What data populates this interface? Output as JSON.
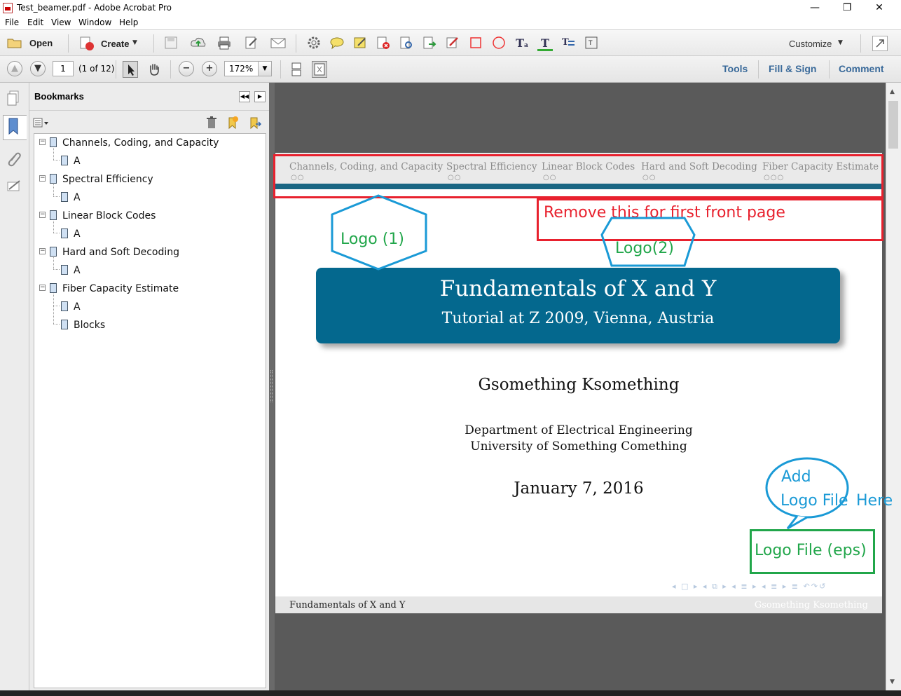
{
  "window": {
    "title": "Test_beamer.pdf - Adobe Acrobat Pro",
    "minimize": "—",
    "restore": "❐",
    "close": "✕"
  },
  "menu": [
    "File",
    "Edit",
    "View",
    "Window",
    "Help"
  ],
  "toolbar": {
    "open_label": "Open",
    "create_label": "Create",
    "customize_label": "Customize",
    "page_number": "1",
    "page_count": "(1 of 12)",
    "zoom": "172%"
  },
  "panes": {
    "tools": "Tools",
    "fill_sign": "Fill & Sign",
    "comment": "Comment"
  },
  "bookmarks": {
    "title": "Bookmarks",
    "items": [
      {
        "label": "Channels, Coding, and Capacity",
        "children": [
          "A"
        ]
      },
      {
        "label": "Spectral Efficiency",
        "children": [
          "A"
        ]
      },
      {
        "label": "Linear Block Codes",
        "children": [
          "A"
        ]
      },
      {
        "label": "Hard and Soft Decoding",
        "children": [
          "A"
        ]
      },
      {
        "label": "Fiber Capacity Estimate",
        "children": [
          "A",
          "Blocks"
        ]
      }
    ]
  },
  "slide": {
    "nav_sections": [
      {
        "label": "Channels, Coding, and Capacity",
        "dots": "○○"
      },
      {
        "label": "Spectral Efficiency",
        "dots": "○○"
      },
      {
        "label": "Linear Block Codes",
        "dots": "○○"
      },
      {
        "label": "Hard and Soft Decoding",
        "dots": "○○"
      },
      {
        "label": "Fiber Capacity Estimate",
        "dots": "○○○"
      }
    ],
    "title": "Fundamentals of X and Y",
    "subtitle": "Tutorial at Z 2009, Vienna, Austria",
    "author": "Gsomething Ksomething",
    "department": "Department of Electrical Engineering",
    "university": "University of Something Comething",
    "date": "January 7, 2016",
    "footer_left": "Fundamentals of X and Y",
    "footer_right": "Gsomething Ksomething",
    "beamer_nav": "◂ □ ▸ ◂ ⧉ ▸ ◂ ≣ ▸ ◂ ≣ ▸    ≣    ↶↷↺"
  },
  "annotations": {
    "remove_text": "Remove this for first front page",
    "logo1": "Logo (1)",
    "logo2": "Logo(2)",
    "add_line1": "Add",
    "add_line2": "Logo File",
    "add_line3": "Here",
    "logo_file": "Logo File (eps)",
    "colors": {
      "red": "#e8212e",
      "blue": "#1a9ad6",
      "green": "#21a64a"
    }
  }
}
